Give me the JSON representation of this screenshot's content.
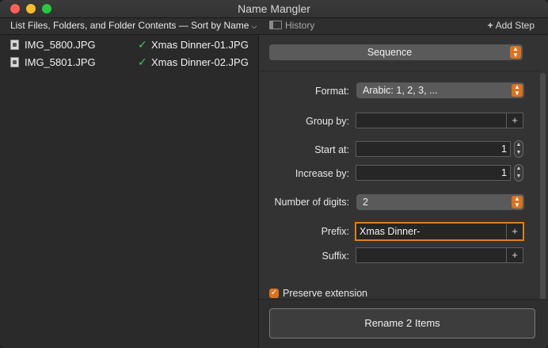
{
  "window": {
    "title": "Name Mangler"
  },
  "toolbar": {
    "sort_menu": "List Files, Folders, and Folder Contents — Sort by Name",
    "history": "History",
    "add_step": "Add Step"
  },
  "files": [
    {
      "name": "IMG_5800.JPG",
      "new_name": "Xmas Dinner-01.JPG"
    },
    {
      "name": "IMG_5801.JPG",
      "new_name": "Xmas Dinner-02.JPG"
    }
  ],
  "step": {
    "type": "Sequence",
    "format_label": "Format:",
    "format_value": "Arabic: 1, 2, 3, ...",
    "group_label": "Group by:",
    "group_value": "",
    "start_label": "Start at:",
    "start_value": "1",
    "increase_label": "Increase by:",
    "increase_value": "1",
    "digits_label": "Number of digits:",
    "digits_value": "2",
    "prefix_label": "Prefix:",
    "prefix_value": "Xmas Dinner-",
    "suffix_label": "Suffix:",
    "suffix_value": "",
    "preserve_label": "Preserve extension",
    "preserve_checked": true
  },
  "actions": {
    "rename": "Rename 2 Items"
  },
  "colors": {
    "accent": "#d9731f",
    "success": "#3ecf4d"
  }
}
